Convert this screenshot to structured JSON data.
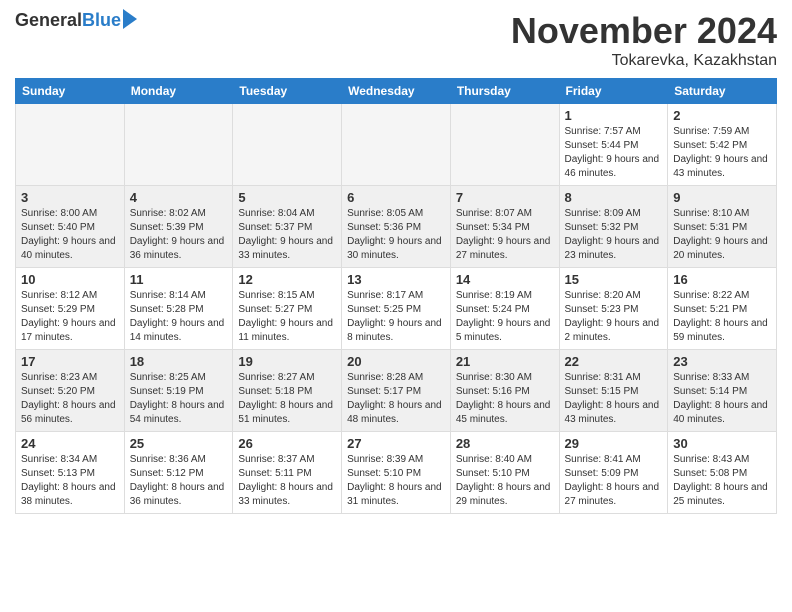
{
  "header": {
    "logo_general": "General",
    "logo_blue": "Blue",
    "month_title": "November 2024",
    "location": "Tokarevka, Kazakhstan"
  },
  "days_of_week": [
    "Sunday",
    "Monday",
    "Tuesday",
    "Wednesday",
    "Thursday",
    "Friday",
    "Saturday"
  ],
  "weeks": [
    [
      {
        "day": "",
        "empty": true
      },
      {
        "day": "",
        "empty": true
      },
      {
        "day": "",
        "empty": true
      },
      {
        "day": "",
        "empty": true
      },
      {
        "day": "",
        "empty": true
      },
      {
        "day": "1",
        "sunrise": "Sunrise: 7:57 AM",
        "sunset": "Sunset: 5:44 PM",
        "daylight": "Daylight: 9 hours and 46 minutes."
      },
      {
        "day": "2",
        "sunrise": "Sunrise: 7:59 AM",
        "sunset": "Sunset: 5:42 PM",
        "daylight": "Daylight: 9 hours and 43 minutes."
      }
    ],
    [
      {
        "day": "3",
        "sunrise": "Sunrise: 8:00 AM",
        "sunset": "Sunset: 5:40 PM",
        "daylight": "Daylight: 9 hours and 40 minutes."
      },
      {
        "day": "4",
        "sunrise": "Sunrise: 8:02 AM",
        "sunset": "Sunset: 5:39 PM",
        "daylight": "Daylight: 9 hours and 36 minutes."
      },
      {
        "day": "5",
        "sunrise": "Sunrise: 8:04 AM",
        "sunset": "Sunset: 5:37 PM",
        "daylight": "Daylight: 9 hours and 33 minutes."
      },
      {
        "day": "6",
        "sunrise": "Sunrise: 8:05 AM",
        "sunset": "Sunset: 5:36 PM",
        "daylight": "Daylight: 9 hours and 30 minutes."
      },
      {
        "day": "7",
        "sunrise": "Sunrise: 8:07 AM",
        "sunset": "Sunset: 5:34 PM",
        "daylight": "Daylight: 9 hours and 27 minutes."
      },
      {
        "day": "8",
        "sunrise": "Sunrise: 8:09 AM",
        "sunset": "Sunset: 5:32 PM",
        "daylight": "Daylight: 9 hours and 23 minutes."
      },
      {
        "day": "9",
        "sunrise": "Sunrise: 8:10 AM",
        "sunset": "Sunset: 5:31 PM",
        "daylight": "Daylight: 9 hours and 20 minutes."
      }
    ],
    [
      {
        "day": "10",
        "sunrise": "Sunrise: 8:12 AM",
        "sunset": "Sunset: 5:29 PM",
        "daylight": "Daylight: 9 hours and 17 minutes."
      },
      {
        "day": "11",
        "sunrise": "Sunrise: 8:14 AM",
        "sunset": "Sunset: 5:28 PM",
        "daylight": "Daylight: 9 hours and 14 minutes."
      },
      {
        "day": "12",
        "sunrise": "Sunrise: 8:15 AM",
        "sunset": "Sunset: 5:27 PM",
        "daylight": "Daylight: 9 hours and 11 minutes."
      },
      {
        "day": "13",
        "sunrise": "Sunrise: 8:17 AM",
        "sunset": "Sunset: 5:25 PM",
        "daylight": "Daylight: 9 hours and 8 minutes."
      },
      {
        "day": "14",
        "sunrise": "Sunrise: 8:19 AM",
        "sunset": "Sunset: 5:24 PM",
        "daylight": "Daylight: 9 hours and 5 minutes."
      },
      {
        "day": "15",
        "sunrise": "Sunrise: 8:20 AM",
        "sunset": "Sunset: 5:23 PM",
        "daylight": "Daylight: 9 hours and 2 minutes."
      },
      {
        "day": "16",
        "sunrise": "Sunrise: 8:22 AM",
        "sunset": "Sunset: 5:21 PM",
        "daylight": "Daylight: 8 hours and 59 minutes."
      }
    ],
    [
      {
        "day": "17",
        "sunrise": "Sunrise: 8:23 AM",
        "sunset": "Sunset: 5:20 PM",
        "daylight": "Daylight: 8 hours and 56 minutes."
      },
      {
        "day": "18",
        "sunrise": "Sunrise: 8:25 AM",
        "sunset": "Sunset: 5:19 PM",
        "daylight": "Daylight: 8 hours and 54 minutes."
      },
      {
        "day": "19",
        "sunrise": "Sunrise: 8:27 AM",
        "sunset": "Sunset: 5:18 PM",
        "daylight": "Daylight: 8 hours and 51 minutes."
      },
      {
        "day": "20",
        "sunrise": "Sunrise: 8:28 AM",
        "sunset": "Sunset: 5:17 PM",
        "daylight": "Daylight: 8 hours and 48 minutes."
      },
      {
        "day": "21",
        "sunrise": "Sunrise: 8:30 AM",
        "sunset": "Sunset: 5:16 PM",
        "daylight": "Daylight: 8 hours and 45 minutes."
      },
      {
        "day": "22",
        "sunrise": "Sunrise: 8:31 AM",
        "sunset": "Sunset: 5:15 PM",
        "daylight": "Daylight: 8 hours and 43 minutes."
      },
      {
        "day": "23",
        "sunrise": "Sunrise: 8:33 AM",
        "sunset": "Sunset: 5:14 PM",
        "daylight": "Daylight: 8 hours and 40 minutes."
      }
    ],
    [
      {
        "day": "24",
        "sunrise": "Sunrise: 8:34 AM",
        "sunset": "Sunset: 5:13 PM",
        "daylight": "Daylight: 8 hours and 38 minutes."
      },
      {
        "day": "25",
        "sunrise": "Sunrise: 8:36 AM",
        "sunset": "Sunset: 5:12 PM",
        "daylight": "Daylight: 8 hours and 36 minutes."
      },
      {
        "day": "26",
        "sunrise": "Sunrise: 8:37 AM",
        "sunset": "Sunset: 5:11 PM",
        "daylight": "Daylight: 8 hours and 33 minutes."
      },
      {
        "day": "27",
        "sunrise": "Sunrise: 8:39 AM",
        "sunset": "Sunset: 5:10 PM",
        "daylight": "Daylight: 8 hours and 31 minutes."
      },
      {
        "day": "28",
        "sunrise": "Sunrise: 8:40 AM",
        "sunset": "Sunset: 5:10 PM",
        "daylight": "Daylight: 8 hours and 29 minutes."
      },
      {
        "day": "29",
        "sunrise": "Sunrise: 8:41 AM",
        "sunset": "Sunset: 5:09 PM",
        "daylight": "Daylight: 8 hours and 27 minutes."
      },
      {
        "day": "30",
        "sunrise": "Sunrise: 8:43 AM",
        "sunset": "Sunset: 5:08 PM",
        "daylight": "Daylight: 8 hours and 25 minutes."
      }
    ]
  ]
}
